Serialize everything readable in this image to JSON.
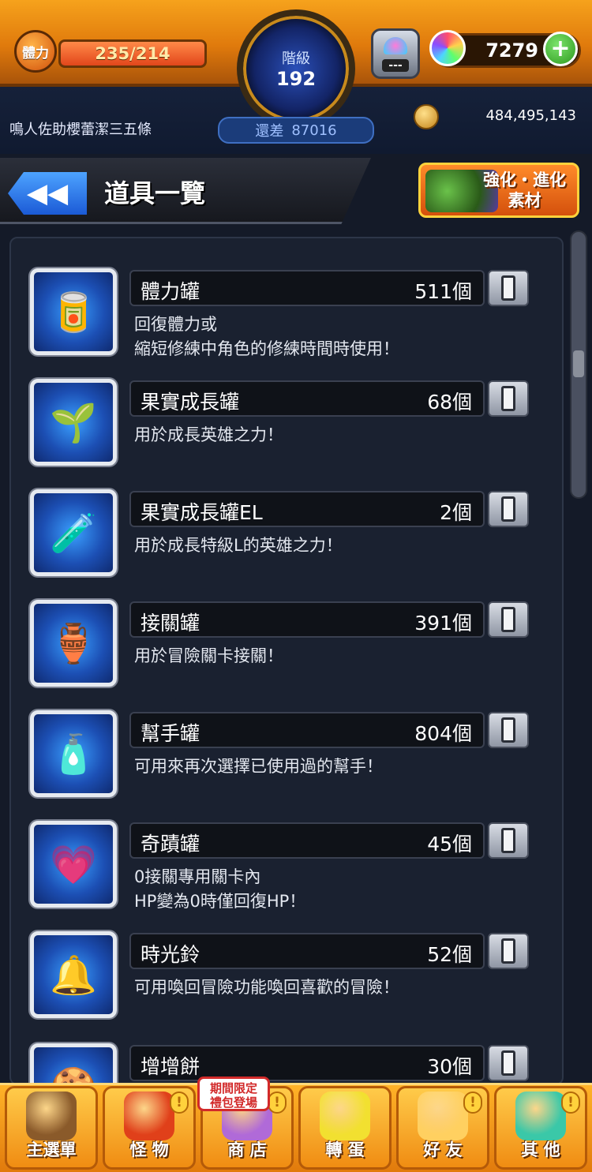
{
  "hud": {
    "stamina_label": "體力",
    "stamina_value": "235/214",
    "stamina_fill_percent": 100,
    "rank_label": "階級",
    "rank_value": "192",
    "exp_label": "還差",
    "exp_value": "87016",
    "gacha_count": "---",
    "orb_count": "7279",
    "plus_label": "+",
    "player_name": "鳴人佐助櫻蕾潔三五條",
    "coin_count": "484,495,143"
  },
  "title_bar": {
    "back_label": "◀◀",
    "title": "道具一覽",
    "material_button_label_line1": "強化・進化",
    "material_button_label_line2": "素材"
  },
  "items": [
    {
      "name": "體力罐",
      "count": "511個",
      "icon": "can-icon",
      "emoji": "🥫",
      "desc": "回復體力或\n縮短修練中角色的修練時間時使用！"
    },
    {
      "name": "果實成長罐",
      "count": "68個",
      "icon": "sprout-bottle-icon",
      "emoji": "🌱",
      "desc": "用於成長英雄之力！"
    },
    {
      "name": "果實成長罐EL",
      "count": "2個",
      "icon": "el-bottle-icon",
      "emoji": "🧪",
      "desc": "用於成長特級L的英雄之力！"
    },
    {
      "name": "接關罐",
      "count": "391個",
      "icon": "continue-jar-icon",
      "emoji": "🏺",
      "desc": "用於冒險關卡接關！"
    },
    {
      "name": "幫手罐",
      "count": "804個",
      "icon": "helper-jar-icon",
      "emoji": "🧴",
      "desc": "可用來再次選擇已使用過的幫手！"
    },
    {
      "name": "奇蹟罐",
      "count": "45個",
      "icon": "miracle-jar-icon",
      "emoji": "💗",
      "desc": "0接關專用關卡內\nHP變為0時僅回復HP！"
    },
    {
      "name": "時光鈴",
      "count": "52個",
      "icon": "time-bell-icon",
      "emoji": "🔔",
      "desc": "可用喚回冒險功能喚回喜歡的冒險！"
    },
    {
      "name": "增增餅",
      "count": "30個",
      "icon": "cookie-icon",
      "emoji": "🍪",
      "desc": ""
    }
  ],
  "bottom_nav": {
    "items": [
      {
        "label": "主選單",
        "icon": "main-menu-icon",
        "alert": false,
        "color": "#8a5a2a"
      },
      {
        "label": "怪 物",
        "icon": "monster-icon",
        "alert": true,
        "color": "#e0401a"
      },
      {
        "label": "商 店",
        "icon": "shop-icon",
        "alert": true,
        "color": "#b06ad8"
      },
      {
        "label": "轉 蛋",
        "icon": "egg-icon",
        "alert": false,
        "color": "#f2e030"
      },
      {
        "label": "好 友",
        "icon": "friends-icon",
        "alert": true,
        "color": "#ffd060"
      },
      {
        "label": "其 他",
        "icon": "other-icon",
        "alert": true,
        "color": "#3ac8a8"
      }
    ],
    "promo_tag": "期間限定\n禮包登場",
    "alert_mark": "!"
  }
}
